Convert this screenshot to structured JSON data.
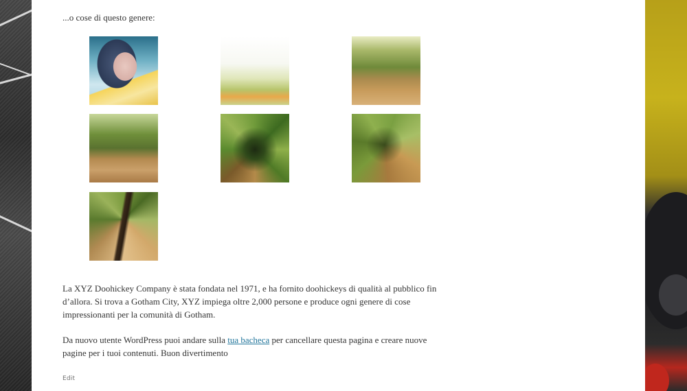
{
  "content": {
    "lead_text": "...o cose di questo genere:",
    "paragraph1": "La XYZ Doohickey Company è stata fondata nel 1971, e ha fornito doohickeys di qualità al pubblico fin d’allora. Si trova a Gotham City, XYZ impiega oltre 2,000 persone e produce ogni genere di cose impressionanti per la comunità di Gotham.",
    "paragraph2_before": "Da nuovo utente WordPress puoi andare sulla ",
    "paragraph2_link": "tua bacheca",
    "paragraph2_after": " per cancellare questa pagina e creare nuove pagine per i tuoi contenuti. Buon divertimento",
    "edit_label": "Edit"
  },
  "gallery": [
    {
      "name": "portrait-photo"
    },
    {
      "name": "bright-grass-photo"
    },
    {
      "name": "forest-path-photo"
    },
    {
      "name": "forest-clearing-photo"
    },
    {
      "name": "zoom-blur-green-photo"
    },
    {
      "name": "zoom-blur-trees-photo"
    },
    {
      "name": "zoom-blur-trunk-photo"
    }
  ],
  "colors": {
    "text": "#333333",
    "link": "#21759b",
    "page_background": "#ffffff"
  }
}
